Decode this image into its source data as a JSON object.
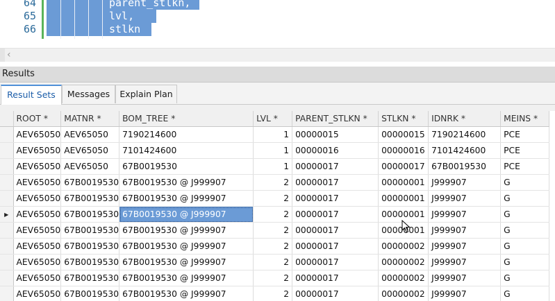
{
  "editor": {
    "lines": [
      {
        "num": "64",
        "code": "parent_stlkn,"
      },
      {
        "num": "65",
        "code": "lvl,"
      },
      {
        "num": "66",
        "code": "stlkn"
      }
    ]
  },
  "results": {
    "title": "Results",
    "tabs": [
      {
        "label": "Result Sets",
        "active": true
      },
      {
        "label": "Messages",
        "active": false
      },
      {
        "label": "Explain Plan",
        "active": false
      }
    ],
    "columns": [
      "ROOT *",
      "MATNR *",
      "BOM_TREE *",
      "LVL *",
      "PARENT_STLKN *",
      "STLKN *",
      "IDNRK *",
      "MEINS *"
    ],
    "rows": [
      [
        "AEV65050",
        "AEV65050",
        "7190214600",
        "1",
        "00000015",
        "00000015",
        "7190214600",
        "PCE"
      ],
      [
        "AEV65050",
        "AEV65050",
        "7101424600",
        "1",
        "00000016",
        "00000016",
        "7101424600",
        "PCE"
      ],
      [
        "AEV65050",
        "AEV65050",
        "67B0019530",
        "1",
        "00000017",
        "00000017",
        "67B0019530",
        "PCE"
      ],
      [
        "AEV65050",
        "67B0019530",
        "67B0019530 @ J999907",
        "2",
        "00000017",
        "00000001",
        "J999907",
        "G"
      ],
      [
        "AEV65050",
        "67B0019530",
        "67B0019530 @ J999907",
        "2",
        "00000017",
        "00000001",
        "J999907",
        "G"
      ],
      [
        "AEV65050",
        "67B0019530",
        "67B0019530 @ J999907",
        "2",
        "00000017",
        "00000001",
        "J999907",
        "G"
      ],
      [
        "AEV65050",
        "67B0019530",
        "67B0019530 @ J999907",
        "2",
        "00000017",
        "00000001",
        "J999907",
        "G"
      ],
      [
        "AEV65050",
        "67B0019530",
        "67B0019530 @ J999907",
        "2",
        "00000017",
        "00000002",
        "J999907",
        "G"
      ],
      [
        "AEV65050",
        "67B0019530",
        "67B0019530 @ J999907",
        "2",
        "00000017",
        "00000002",
        "J999907",
        "G"
      ],
      [
        "AEV65050",
        "67B0019530",
        "67B0019530 @ J999907",
        "2",
        "00000017",
        "00000002",
        "J999907",
        "G"
      ],
      [
        "AEV65050",
        "67B0019530",
        "67B0019530 @ J999907",
        "2",
        "00000017",
        "00000002",
        "J999907",
        "G"
      ]
    ],
    "current_row_index": 5,
    "selected_cell": {
      "row": 5,
      "col": 2
    },
    "row_indicator_icon": "row-pointer-icon"
  },
  "colors": {
    "selection": "#6b9bd6",
    "line_numbers": "#2b6a9a",
    "change_bar": "#5ab35a",
    "active_tab_accent": "#4f8fd8"
  }
}
